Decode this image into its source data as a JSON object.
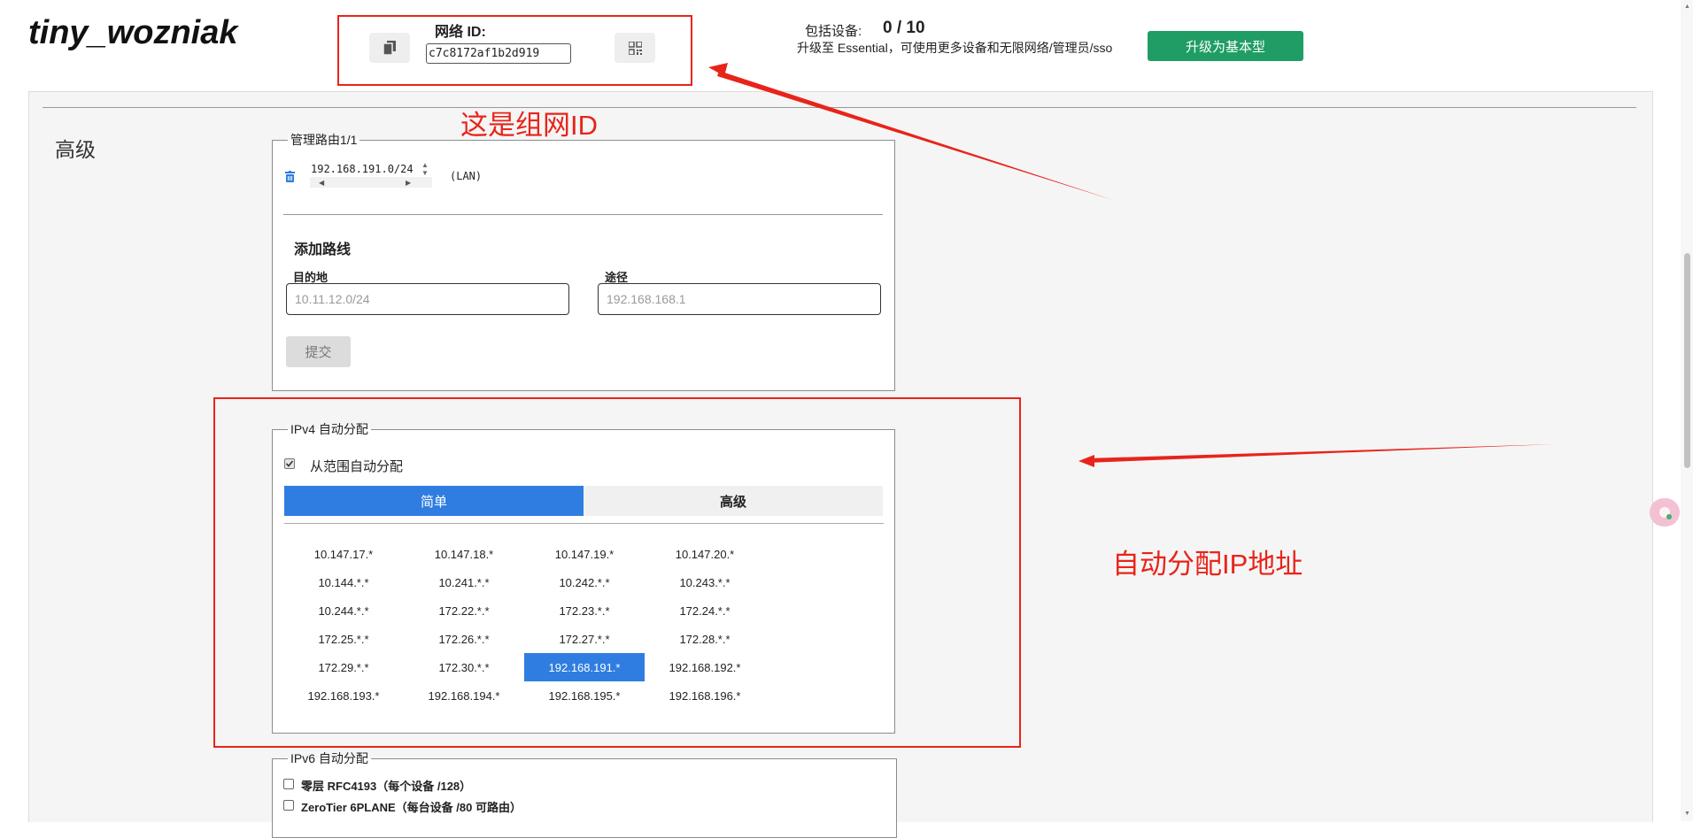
{
  "header": {
    "app_title": "tiny_wozniak",
    "network_id_label": "网络 ID:",
    "network_id_value": "c7c8172af1b2d919",
    "devices_label": "包括设备:",
    "devices_count": "0 / 10",
    "upgrade_description": "升级至 Essential，可使用更多设备和无限网络/管理员/sso",
    "upgrade_button": "升级为基本型",
    "icons": [
      "copy-icon",
      "qr-code-icon"
    ]
  },
  "section": {
    "title": "高级"
  },
  "routes": {
    "legend": "管理路由1/1",
    "items": [
      {
        "target": "192.168.191.0/24",
        "via": "(LAN)"
      }
    ],
    "add_route": {
      "title": "添加路线",
      "destination_label": "目的地",
      "destination_placeholder": "10.11.12.0/24",
      "via_label": "途径",
      "via_placeholder": "192.168.168.1",
      "submit_label": "提交"
    }
  },
  "ipv4": {
    "legend": "IPv4 自动分配",
    "auto_assign_label": "从范围自动分配",
    "auto_assign_checked": true,
    "tabs": [
      "简单",
      "高级"
    ],
    "active_tab": "简单",
    "ranges": [
      "10.147.17.*",
      "10.147.18.*",
      "10.147.19.*",
      "10.147.20.*",
      "10.144.*.*",
      "10.241.*.*",
      "10.242.*.*",
      "10.243.*.*",
      "10.244.*.*",
      "172.22.*.*",
      "172.23.*.*",
      "172.24.*.*",
      "172.25.*.*",
      "172.26.*.*",
      "172.27.*.*",
      "172.28.*.*",
      "172.29.*.*",
      "172.30.*.*",
      "192.168.191.*",
      "192.168.192.*",
      "192.168.193.*",
      "192.168.194.*",
      "192.168.195.*",
      "192.168.196.*"
    ],
    "selected_range": "192.168.191.*"
  },
  "ipv6": {
    "legend": "IPv6 自动分配",
    "options": [
      {
        "label": "零层 RFC4193（每个设备 /128）",
        "checked": false
      },
      {
        "label": "ZeroTier 6PLANE（每台设备 /80 可路由）",
        "checked": false
      }
    ]
  },
  "annotations": {
    "network_id_note": "这是组网ID",
    "auto_ip_note": "自动分配IP地址",
    "color": "#e8241a"
  },
  "colors": {
    "primary_blue": "#2f7de1",
    "upgrade_green": "#1f9d64"
  }
}
